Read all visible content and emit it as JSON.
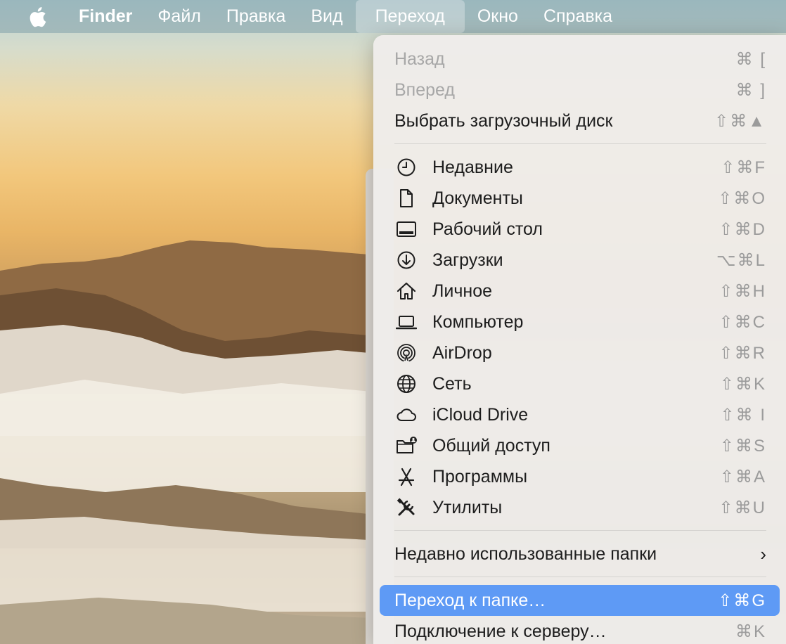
{
  "menubar": {
    "apple_icon": "apple-logo-icon",
    "items": [
      {
        "label": "Finder"
      },
      {
        "label": "Файл"
      },
      {
        "label": "Правка"
      },
      {
        "label": "Вид"
      },
      {
        "label": "Переход"
      },
      {
        "label": "Окно"
      },
      {
        "label": "Справка"
      }
    ]
  },
  "menu": {
    "top": [
      {
        "label": "Назад",
        "shortcut": "⌘ [",
        "enabled": false
      },
      {
        "label": "Вперед",
        "shortcut": "⌘ ]",
        "enabled": false
      },
      {
        "label": "Выбрать загрузочный диск",
        "shortcut": "⇧⌘▲",
        "enabled": true
      }
    ],
    "places": [
      {
        "label": "Недавние",
        "shortcut": "⇧⌘F",
        "icon": "clock-icon"
      },
      {
        "label": "Документы",
        "shortcut": "⇧⌘O",
        "icon": "document-icon"
      },
      {
        "label": "Рабочий стол",
        "shortcut": "⇧⌘D",
        "icon": "desktop-icon"
      },
      {
        "label": "Загрузки",
        "shortcut": "⌥⌘L",
        "icon": "download-icon"
      },
      {
        "label": "Личное",
        "shortcut": "⇧⌘H",
        "icon": "home-icon"
      },
      {
        "label": "Компьютер",
        "shortcut": "⇧⌘C",
        "icon": "laptop-icon"
      },
      {
        "label": "AirDrop",
        "shortcut": "⇧⌘R",
        "icon": "airdrop-icon"
      },
      {
        "label": "Сеть",
        "shortcut": "⇧⌘K",
        "icon": "globe-icon"
      },
      {
        "label": "iCloud Drive",
        "shortcut": "⇧⌘ I",
        "icon": "cloud-icon"
      },
      {
        "label": "Общий доступ",
        "shortcut": "⇧⌘S",
        "icon": "shared-folder-icon"
      },
      {
        "label": "Программы",
        "shortcut": "⇧⌘A",
        "icon": "apps-icon"
      },
      {
        "label": "Утилиты",
        "shortcut": "⇧⌘U",
        "icon": "tools-icon"
      }
    ],
    "recent_folders": {
      "label": "Недавно использованные папки"
    },
    "bottom": [
      {
        "label": "Переход к папке…",
        "shortcut": "⇧⌘G",
        "highlighted": true
      },
      {
        "label": "Подключение к серверу…",
        "shortcut": "⌘K",
        "highlighted": false
      }
    ]
  },
  "colors": {
    "highlight": "#5e9af5",
    "menu_bg": "#eeecea",
    "disabled_text": "#a7a7a7"
  }
}
